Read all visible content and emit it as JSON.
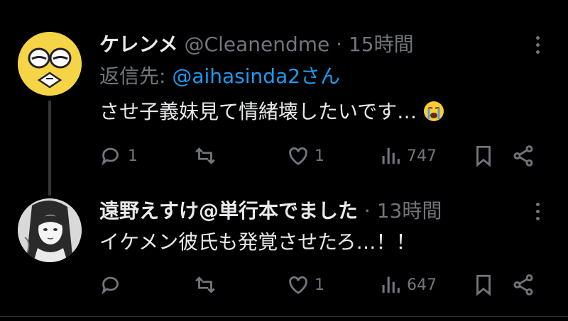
{
  "tweets": [
    {
      "display_name": "ケレンメ",
      "handle": "@Cleanendme",
      "separator": "·",
      "time": "15時間",
      "reply_to_label": "返信先:",
      "reply_to_handle": "@aihasinda2さん",
      "text": "させ子義妹見て情緒壊したいです…",
      "emoji": "loudly-crying-face",
      "stats": {
        "replies": "1",
        "reposts": "",
        "likes": "1",
        "views": "747"
      },
      "avatar": {
        "bg": "#f5d547",
        "type": "cartoon-face"
      }
    },
    {
      "display_name": "遠野えすけ@単行本でました",
      "separator": "·",
      "time": "13時間",
      "text": "イケメン彼氏も発覚させたろ…！！",
      "stats": {
        "replies": "",
        "reposts": "",
        "likes": "1",
        "views": "647"
      },
      "avatar": {
        "bg": "#dcdcdc",
        "type": "manga-portrait"
      }
    }
  ],
  "colors": {
    "background": "#000000",
    "text": "#e7e9ea",
    "muted": "#71767b",
    "link": "#1d9bf0",
    "thread_line": "#333639"
  }
}
